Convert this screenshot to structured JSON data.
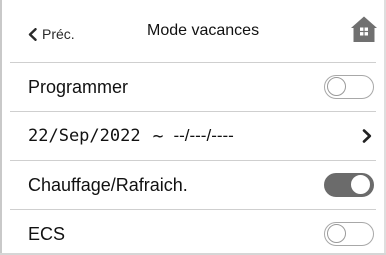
{
  "header": {
    "back_label": "Préc.",
    "title": "Mode vacances",
    "back_icon": "chevron-left-icon",
    "home_icon": "home-icon"
  },
  "rows": {
    "programmer": {
      "label": "Programmer",
      "state": "off"
    },
    "dates": {
      "start": "22/Sep/2022",
      "separator": "~",
      "end": "--/---/----",
      "icon": "chevron-right-icon"
    },
    "chauffage": {
      "label": "Chauffage/Rafraich.",
      "state": "on"
    },
    "ecs": {
      "label": "ECS",
      "state": "off"
    }
  },
  "colors": {
    "toggle_on": "#6b6b6b",
    "toggle_off_border": "#a8a8a8",
    "home_icon": "#707070",
    "divider": "#cfcfcf"
  }
}
